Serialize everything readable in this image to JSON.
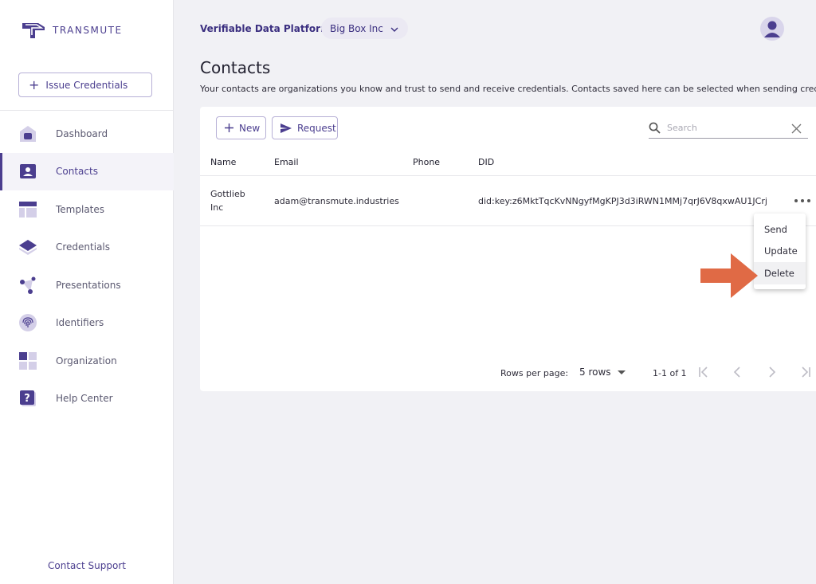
{
  "brand": {
    "name": "TRANSMUTE",
    "color": "#4b3e8f"
  },
  "sidebar": {
    "issue_button": "Issue Credentials",
    "items": [
      {
        "label": "Dashboard",
        "icon": "home-icon"
      },
      {
        "label": "Contacts",
        "icon": "contact-card-icon",
        "active": true
      },
      {
        "label": "Templates",
        "icon": "template-icon"
      },
      {
        "label": "Credentials",
        "icon": "layers-icon"
      },
      {
        "label": "Presentations",
        "icon": "network-icon"
      },
      {
        "label": "Identifiers",
        "icon": "fingerprint-icon"
      },
      {
        "label": "Organization",
        "icon": "grid-icon"
      },
      {
        "label": "Help Center",
        "icon": "help-icon"
      }
    ],
    "support": "Contact Support"
  },
  "header": {
    "platform": "Verifiable Data Platform",
    "org": "Big Box Inc"
  },
  "page": {
    "title": "Contacts",
    "description": "Your contacts are organizations you know and trust to send and receive credentials. Contacts saved here can be selected when sending credentials."
  },
  "toolbar": {
    "new_label": "New",
    "request_label": "Request",
    "search_placeholder": "Search"
  },
  "table": {
    "columns": [
      "Name",
      "Email",
      "Phone",
      "DID"
    ],
    "rows": [
      {
        "name_line1": "Gottlieb",
        "name_line2": "Inc",
        "email": "adam@transmute.industries",
        "phone": "",
        "did": "did:key:z6MktTqcKvNNgyfMgKPJ3d3iRWN1MMj7qrJ6V8qxwAU1JCrj"
      }
    ]
  },
  "pagination": {
    "rows_label": "Rows per page:",
    "rows_value": "5 rows",
    "range": "1-1 of 1"
  },
  "context_menu": {
    "items": [
      "Send",
      "Update",
      "Delete"
    ]
  },
  "colors": {
    "accent": "#4b3e8f",
    "arrow": "#e06a45",
    "background": "#f1f1f5"
  }
}
